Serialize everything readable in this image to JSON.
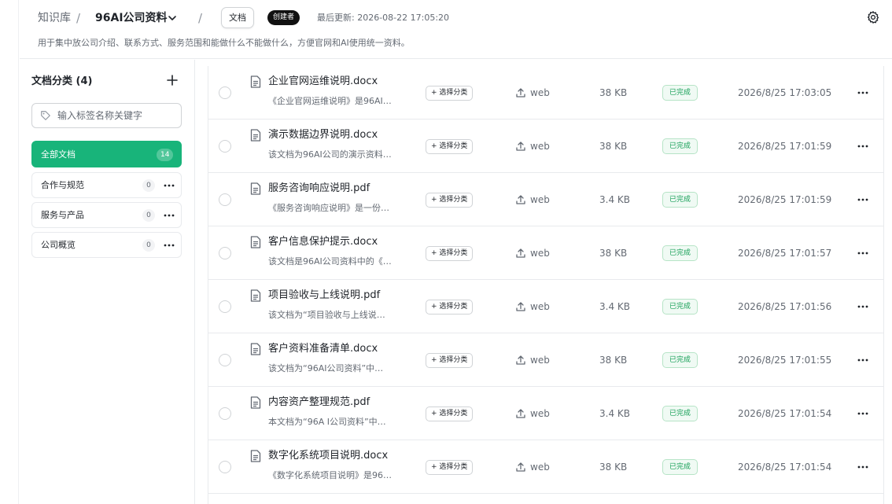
{
  "header": {
    "breadcrumb_root": "知识库",
    "separator": "/",
    "kb_name": "96AI公司资料",
    "tab_label": "文档",
    "creator_badge": "创建者",
    "last_updated": "最后更新: 2026-08-22 17:05:20",
    "description": "用于集中放公司介绍、联系方式、服务范围和能做什么不能做什么，方便官网和AI使用统一资料。"
  },
  "sidebar": {
    "title": "文档分类 (4)",
    "search_placeholder": "输入标签名称关键字",
    "categories": [
      {
        "label": "全部文档",
        "count": "14",
        "active": true
      },
      {
        "label": "合作与规范",
        "count": "0"
      },
      {
        "label": "服务与产品",
        "count": "0"
      },
      {
        "label": "公司概览",
        "count": "0"
      }
    ]
  },
  "documents": [
    {
      "name": "企业官网运维说明.docx",
      "summary": "《企业官网运维说明》是96AI…",
      "category_button": "+ 选择分类",
      "source": "web",
      "size": "38 KB",
      "status": "已完成",
      "time": "2026/8/25 17:03:05"
    },
    {
      "name": "演示数据边界说明.docx",
      "summary": "该文档为96AI公司的演示资料…",
      "category_button": "+ 选择分类",
      "source": "web",
      "size": "38 KB",
      "status": "已完成",
      "time": "2026/8/25 17:01:59"
    },
    {
      "name": "服务咨询响应说明.pdf",
      "summary": "《服务咨询响应说明》是一份…",
      "category_button": "+ 选择分类",
      "source": "web",
      "size": "3.4 KB",
      "status": "已完成",
      "time": "2026/8/25 17:01:59"
    },
    {
      "name": "客户信息保护提示.docx",
      "summary": "该文档是96AI公司资料中的《…",
      "category_button": "+ 选择分类",
      "source": "web",
      "size": "38 KB",
      "status": "已完成",
      "time": "2026/8/25 17:01:57"
    },
    {
      "name": "项目验收与上线说明.pdf",
      "summary": "该文档为“项目验收与上线说…",
      "category_button": "+ 选择分类",
      "source": "web",
      "size": "3.4 KB",
      "status": "已完成",
      "time": "2026/8/25 17:01:56"
    },
    {
      "name": "客户资料准备清单.docx",
      "summary": "该文档为“96AI公司资料”中…",
      "category_button": "+ 选择分类",
      "source": "web",
      "size": "38 KB",
      "status": "已完成",
      "time": "2026/8/25 17:01:55"
    },
    {
      "name": "内容资产整理规范.pdf",
      "summary": "本文档为“96A I公司资料”中…",
      "category_button": "+ 选择分类",
      "source": "web",
      "size": "3.4 KB",
      "status": "已完成",
      "time": "2026/8/25 17:01:54"
    },
    {
      "name": "数字化系统项目说明.docx",
      "summary": "《数字化系统项目说明》是96…",
      "category_button": "+ 选择分类",
      "source": "web",
      "size": "38 KB",
      "status": "已完成",
      "time": "2026/8/25 17:01:54"
    }
  ],
  "colors": {
    "accent": "#18b47a",
    "status_text": "#18a058",
    "badge_bg": "#111111"
  }
}
